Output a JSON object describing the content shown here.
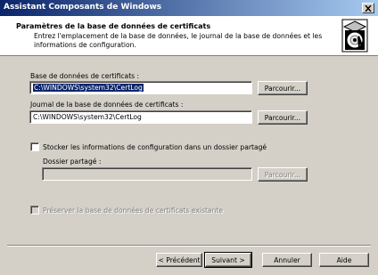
{
  "window": {
    "title": "Assistant Composants de Windows"
  },
  "header": {
    "title": "Paramètres de la base de données de certificats",
    "description": "Entrez l'emplacement de la base de données, le journal de la base de données et les informations de configuration."
  },
  "database": {
    "label": "Base de données de certificats :",
    "value": "C:\\WINDOWS\\system32\\CertLog",
    "browse": "Parcourir..."
  },
  "log": {
    "label": "Journal de la base de données de certificats :",
    "value": "C:\\WINDOWS\\system32\\CertLog",
    "browse": "Parcourir..."
  },
  "shared": {
    "checkbox_label": "Stocker les informations de configuration dans un dossier partagé",
    "folder_label": "Dossier partagé :",
    "value": "",
    "browse": "Parcourir..."
  },
  "preserve": {
    "label": "Préserver la base de données de certificats existante"
  },
  "buttons": {
    "back": "< Précédent",
    "next": "Suivant >",
    "cancel": "Annuler",
    "help": "Aide"
  }
}
